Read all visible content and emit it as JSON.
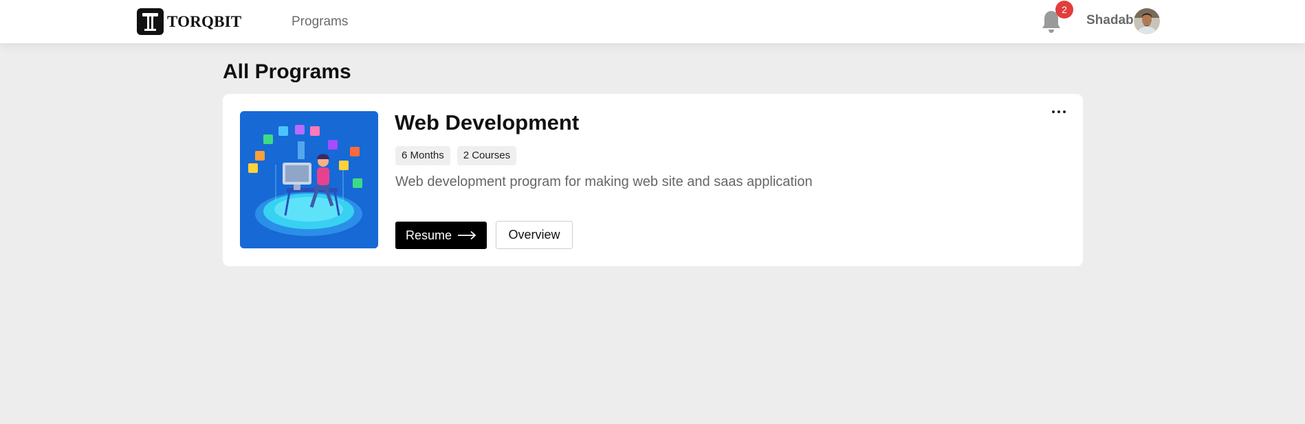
{
  "header": {
    "brand": "TORQBIT",
    "nav": {
      "programs_label": "Programs"
    },
    "notifications": {
      "count": "2"
    },
    "user": {
      "name": "Shadab"
    }
  },
  "main": {
    "title": "All Programs",
    "programs": [
      {
        "title": "Web Development",
        "duration": "6 Months",
        "courses": "2 Courses",
        "description": "Web development program for making web site and saas application",
        "resume_label": "Resume",
        "overview_label": "Overview"
      }
    ]
  },
  "icons": {
    "brand_mark": "torqbit-logo-icon",
    "notifications": "bell-icon",
    "more": "more-horizontal-icon",
    "resume": "arrow-right-icon"
  },
  "colors": {
    "badge": "#e23d3d",
    "primary_button": "#000000",
    "background": "#ededed"
  }
}
